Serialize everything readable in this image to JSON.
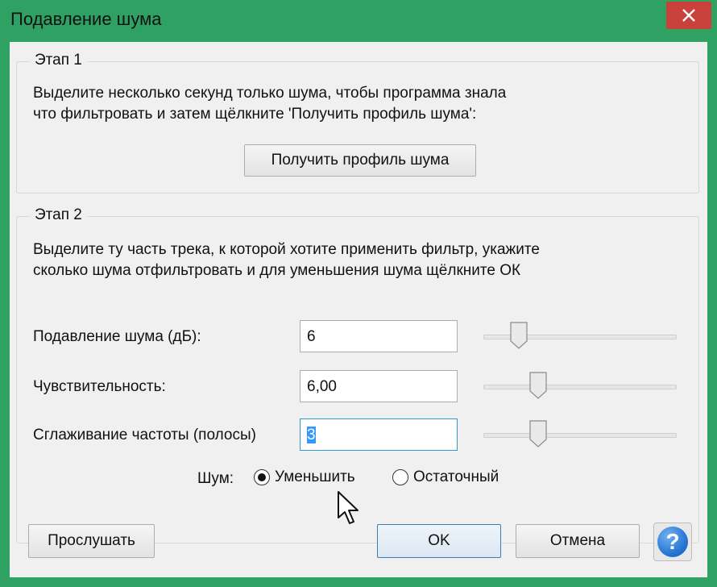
{
  "window": {
    "title": "Подавление шума",
    "close_icon": "close-icon"
  },
  "step1": {
    "legend": "Этап 1",
    "desc_line1": "Выделите несколько секунд только шума, чтобы программа знала",
    "desc_line2": "что фильтровать и затем щёлкните 'Получить профиль шума':",
    "button": "Получить профиль шума"
  },
  "step2": {
    "legend": "Этап 2",
    "desc_line1": "Выделите ту часть трека, к которой хотите применить фильтр, укажите",
    "desc_line2": "сколько шума отфильтровать и для уменьшения шума щёлкните ОК",
    "params": [
      {
        "label": "Подавление шума (дБ):",
        "value": "6",
        "slider_fraction": 0.15
      },
      {
        "label": "Чувствительность:",
        "value": "6,00",
        "slider_fraction": 0.26
      },
      {
        "label": "Сглаживание частоты (полосы)",
        "value": "3",
        "slider_fraction": 0.26
      }
    ],
    "noise_label": "Шум:",
    "radio_reduce": "Уменьшить",
    "radio_residual": "Остаточный",
    "noise_selected": "Уменьшить"
  },
  "footer": {
    "preview": "Прослушать",
    "ok": "OK",
    "cancel": "Отмена",
    "help_icon": "help-icon",
    "help_glyph": "?"
  },
  "colors": {
    "titlebar": "#2fa163",
    "close": "#c9413a",
    "dialog": "#f0f0f0",
    "selection": "#3399ff",
    "help": "#1f6fcf"
  }
}
